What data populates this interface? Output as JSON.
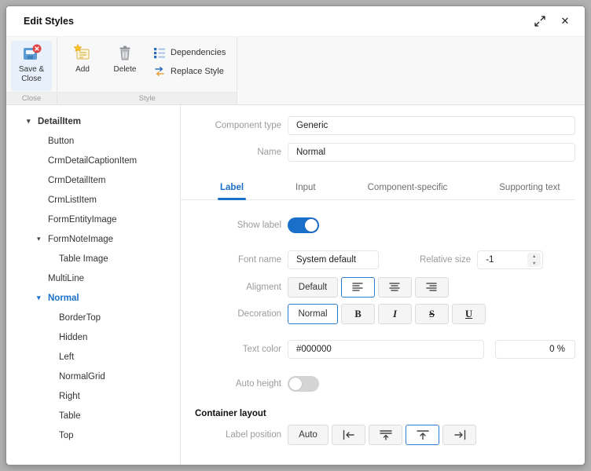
{
  "accent_color": "#1a6fc9",
  "window": {
    "title": "Edit Styles"
  },
  "ribbon": {
    "save_close_label": "Save & Close",
    "add_label": "Add",
    "delete_label": "Delete",
    "dependencies_label": "Dependencies",
    "replace_style_label": "Replace Style",
    "group_close_caption": "Close",
    "group_style_caption": "Style"
  },
  "tree": {
    "items": [
      {
        "label": "DetailItem"
      },
      {
        "label": "Button"
      },
      {
        "label": "CrmDetailCaptionItem"
      },
      {
        "label": "CrmDetailItem"
      },
      {
        "label": "CrmListItem"
      },
      {
        "label": "FormEntityImage"
      },
      {
        "label": "FormNoteImage"
      },
      {
        "label": "Table Image"
      },
      {
        "label": "MultiLine"
      },
      {
        "label": "Normal"
      },
      {
        "label": "BorderTop"
      },
      {
        "label": "Hidden"
      },
      {
        "label": "Left"
      },
      {
        "label": "NormalGrid"
      },
      {
        "label": "Right"
      },
      {
        "label": "Table"
      },
      {
        "label": "Top"
      }
    ]
  },
  "form": {
    "component_type": {
      "label": "Component type",
      "value": "Generic"
    },
    "name": {
      "label": "Name",
      "value": "Normal"
    },
    "tabs": [
      "Label",
      "Input",
      "Component-specific",
      "Supporting text"
    ],
    "show_label": {
      "label": "Show label",
      "on": true
    },
    "font_name": {
      "label": "Font name",
      "value": "System default"
    },
    "relative_size": {
      "label": "Relative size",
      "value": "-1"
    },
    "alignment": {
      "label": "Aligment",
      "default_label": "Default"
    },
    "decoration": {
      "label": "Decoration",
      "normal_label": "Normal",
      "bold_label": "B",
      "italic_label": "I",
      "strike_label": "S",
      "underline_label": "U"
    },
    "text_color": {
      "label": "Text color",
      "value": "#000000",
      "percent_value": "0 %"
    },
    "auto_height": {
      "label": "Auto height",
      "on": false
    },
    "container_layout_label": "Container layout",
    "label_position": {
      "label": "Label position",
      "auto_label": "Auto"
    }
  }
}
